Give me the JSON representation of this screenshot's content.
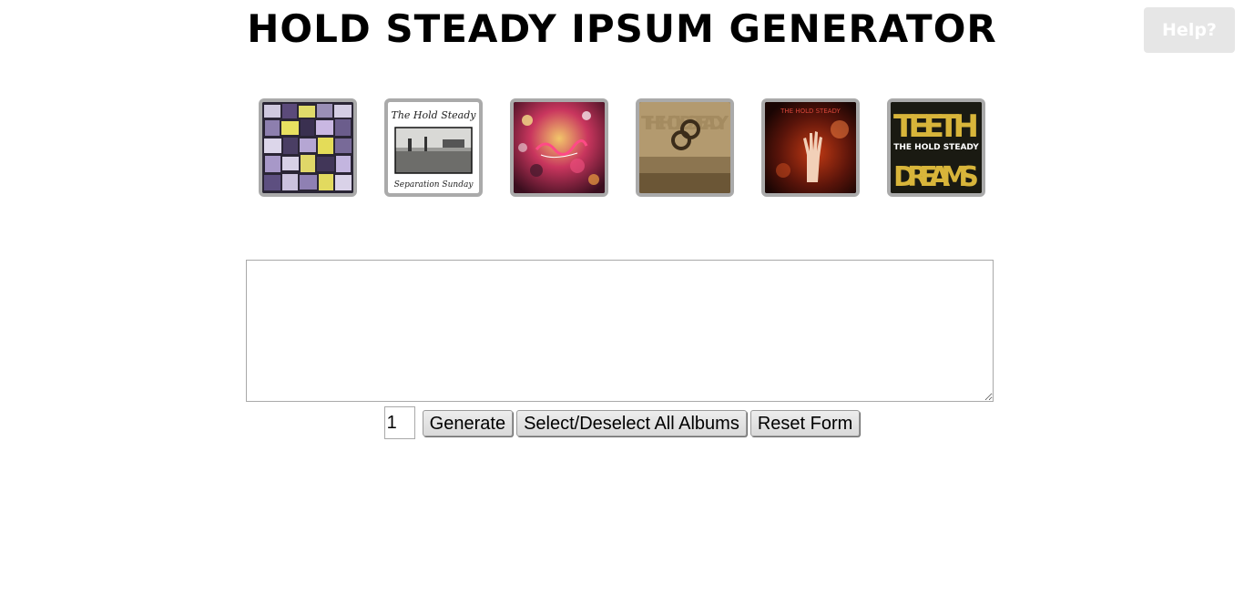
{
  "header": {
    "title": "HOLD STEADY IPSUM GENERATOR",
    "help_label": "Help?"
  },
  "albums": [
    {
      "id": "album-1",
      "icon": "photo-collage-cover",
      "cover_text": "",
      "colors": [
        "#2a2535",
        "#b89fd6",
        "#e8e060"
      ]
    },
    {
      "id": "album-2",
      "icon": "separation-sunday-cover",
      "cover_text": "The Hold Steady",
      "cover_subtext": "Separation Sunday",
      "colors": [
        "#ffffff",
        "#8a8a88",
        "#1a1a1a"
      ]
    },
    {
      "id": "album-3",
      "icon": "crowd-party-cover",
      "cover_text": "",
      "colors": [
        "#7a1f3e",
        "#e33a6b",
        "#f0b04a"
      ]
    },
    {
      "id": "album-4",
      "icon": "sepia-landscape-cover",
      "cover_text": "THE HOLD STEADY",
      "colors": [
        "#b39a6f",
        "#6b5636",
        "#3b2c1a"
      ]
    },
    {
      "id": "album-5",
      "icon": "raised-hand-cover",
      "cover_text": "THE HOLD STEADY",
      "colors": [
        "#2b0a06",
        "#c23a14",
        "#f2d0b8"
      ]
    },
    {
      "id": "album-6",
      "icon": "teeth-dreams-cover",
      "cover_text": "THE HOLD STEADY",
      "cover_subtext": "TEETH DREAMS",
      "colors": [
        "#1a1a12",
        "#d8b53a",
        "#ffffff"
      ]
    }
  ],
  "output": {
    "value": "",
    "placeholder": ""
  },
  "controls": {
    "count_value": "1",
    "generate_label": "Generate",
    "select_all_label": "Select/Deselect All Albums",
    "reset_label": "Reset Form"
  }
}
